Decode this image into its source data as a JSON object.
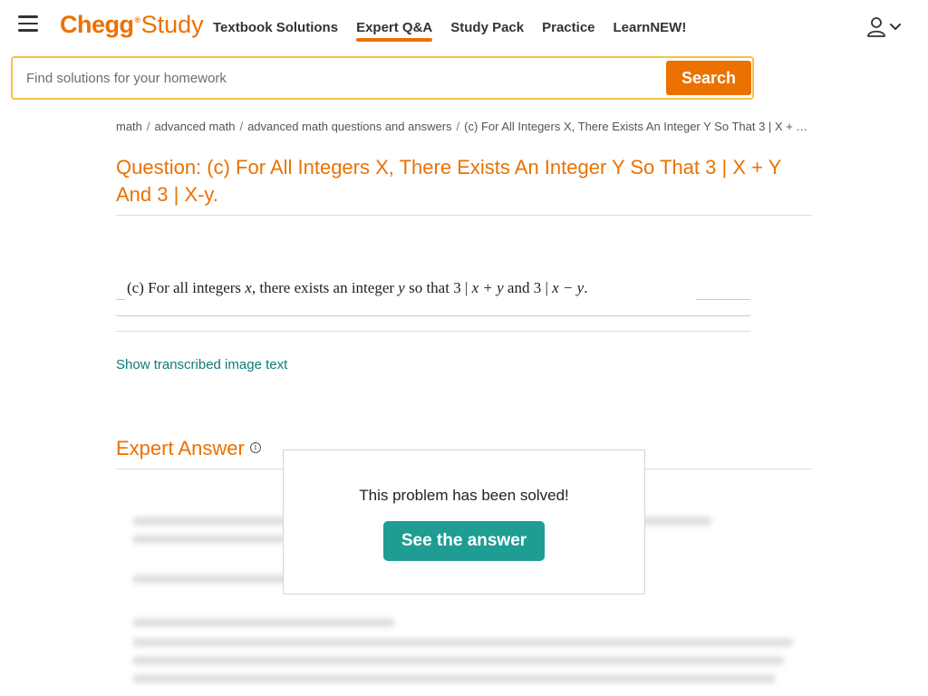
{
  "header": {
    "logo_main": "Chegg",
    "logo_reg": "®",
    "logo_sub": "Study",
    "nav": [
      {
        "label": "Textbook Solutions"
      },
      {
        "label": "Expert Q&A"
      },
      {
        "label": "Study Pack"
      },
      {
        "label": "Practice"
      },
      {
        "label": "LearnNEW!"
      }
    ],
    "active_nav": "Expert Q&A"
  },
  "search": {
    "placeholder": "Find solutions for your homework",
    "button_label": "Search"
  },
  "breadcrumb": [
    "math",
    "advanced math",
    "advanced math questions and answers",
    "(c) For All Integers X, There Exists An Integer Y So That 3 | X + Y And 3 | X-y."
  ],
  "question": {
    "title": "Question: (c) For All Integers X, There Exists An Integer Y So That 3 | X + Y And 3 | X-y.",
    "image_text": {
      "lead": "(c) For all integers ",
      "v1": "x",
      "mid": ", there exists an integer ",
      "v2": "y",
      "tail": " so that 3 | ",
      "expr1": "x + y",
      "and": " and 3 | ",
      "expr2": "x − y",
      "end": "."
    },
    "show_transcribed": "Show transcribed image text"
  },
  "expert_answer": {
    "title": "Expert Answer",
    "info_glyph": "i",
    "overlay_message": "This problem has been solved!",
    "overlay_button": "See the answer"
  },
  "colors": {
    "brand_orange": "#eb7100",
    "search_border": "#f3c14b",
    "teal_button": "#1f9d92",
    "link_teal": "#0c7b7b"
  },
  "icons": {
    "menu": "hamburger-menu-icon",
    "user": "user-icon",
    "chevron": "chevron-down-icon",
    "info": "info-icon"
  }
}
